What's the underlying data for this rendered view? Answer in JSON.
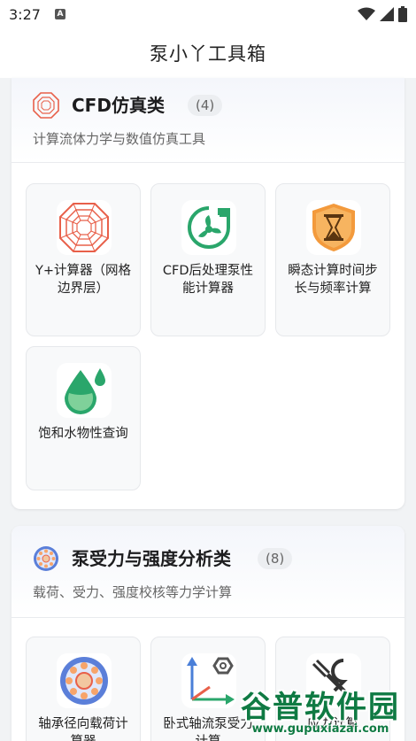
{
  "status": {
    "time": "3:27"
  },
  "app": {
    "title": "泵小丫工具箱"
  },
  "categories": [
    {
      "title": "CFD仿真类",
      "count": "(4)",
      "desc": "计算流体力学与数值仿真工具",
      "tools": [
        {
          "label": "Y+计算器（网格边界层）",
          "icon": "mesh-octagon-icon"
        },
        {
          "label": "CFD后处理泵性能计算器",
          "icon": "fan-pump-icon"
        },
        {
          "label": "瞬态计算时间步长与频率计算",
          "icon": "hourglass-icon"
        },
        {
          "label": "饱和水物性查询",
          "icon": "water-drop-icon"
        }
      ]
    },
    {
      "title": "泵受力与强度分析类",
      "count": "(8)",
      "desc": "载荷、受力、强度校核等力学计算",
      "tools": [
        {
          "label": "轴承径向载荷计算器",
          "icon": "bearing-icon"
        },
        {
          "label": "卧式轴流泵受力计算",
          "icon": "axes-nut-icon"
        },
        {
          "label": "应力计算",
          "icon": "wrench-icon"
        }
      ]
    }
  ],
  "watermark": {
    "name": "谷普软件园",
    "url": "www.gupuxiazai.com"
  },
  "colors": {
    "accent": "#e8604a",
    "green": "#2aa66b",
    "orange": "#f39a3c",
    "watermark": "#0f7a43"
  }
}
